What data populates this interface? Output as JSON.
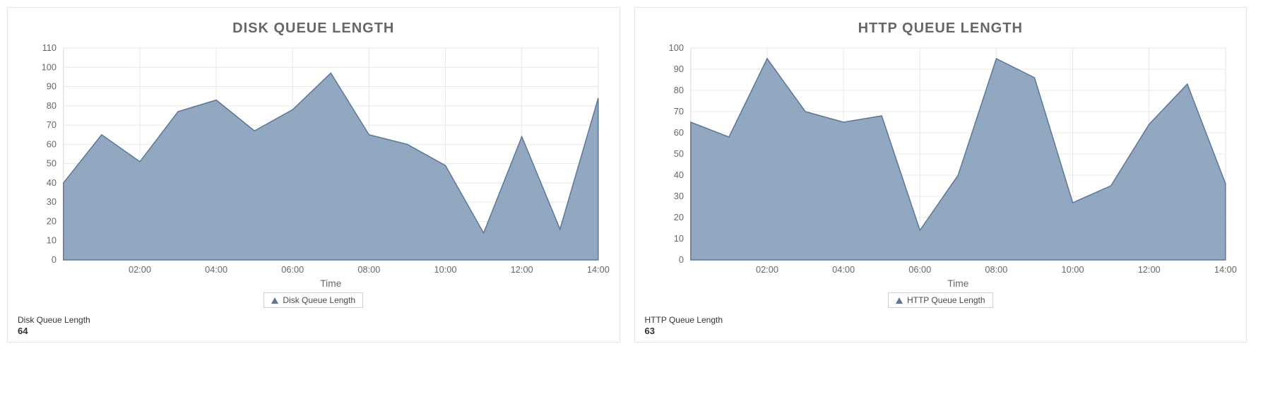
{
  "panels": [
    {
      "title": "DISK QUEUE LENGTH",
      "xlabel": "Time",
      "legend_label": "Disk Queue Length",
      "metric_label": "Disk Queue Length",
      "metric_value": "64"
    },
    {
      "title": "HTTP QUEUE LENGTH",
      "xlabel": "Time",
      "legend_label": "HTTP Queue Length",
      "metric_label": "HTTP Queue Length",
      "metric_value": "63"
    }
  ],
  "chart_data": [
    {
      "type": "area",
      "title": "DISK QUEUE LENGTH",
      "xlabel": "Time",
      "ylabel": "",
      "x_ticks": [
        "02:00",
        "04:00",
        "06:00",
        "08:00",
        "10:00",
        "12:00",
        "14:00"
      ],
      "y_ticks": [
        0,
        10,
        20,
        30,
        40,
        50,
        60,
        70,
        80,
        90,
        100,
        110
      ],
      "ylim": [
        0,
        110
      ],
      "series": [
        {
          "name": "Disk Queue Length",
          "x": [
            "00:00",
            "01:00",
            "02:00",
            "03:00",
            "04:00",
            "05:00",
            "06:00",
            "07:00",
            "08:00",
            "09:00",
            "10:00",
            "11:00",
            "12:00",
            "13:00",
            "14:00"
          ],
          "values": [
            40,
            65,
            51,
            77,
            83,
            67,
            78,
            97,
            65,
            60,
            49,
            14,
            64,
            16,
            84
          ]
        }
      ],
      "legend": [
        "Disk Queue Length"
      ],
      "color": "#8ca2bd"
    },
    {
      "type": "area",
      "title": "HTTP QUEUE LENGTH",
      "xlabel": "Time",
      "ylabel": "",
      "x_ticks": [
        "02:00",
        "04:00",
        "06:00",
        "08:00",
        "10:00",
        "12:00",
        "14:00"
      ],
      "y_ticks": [
        0,
        10,
        20,
        30,
        40,
        50,
        60,
        70,
        80,
        90,
        100
      ],
      "ylim": [
        0,
        100
      ],
      "series": [
        {
          "name": "HTTP Queue Length",
          "x": [
            "00:00",
            "01:00",
            "02:00",
            "03:00",
            "04:00",
            "05:00",
            "06:00",
            "07:00",
            "08:00",
            "09:00",
            "10:00",
            "11:00",
            "12:00",
            "13:00",
            "14:00"
          ],
          "values": [
            65,
            58,
            95,
            70,
            65,
            68,
            14,
            40,
            95,
            86,
            27,
            35,
            64,
            83,
            36
          ]
        }
      ],
      "legend": [
        "HTTP Queue Length"
      ],
      "color": "#8ca2bd"
    }
  ]
}
